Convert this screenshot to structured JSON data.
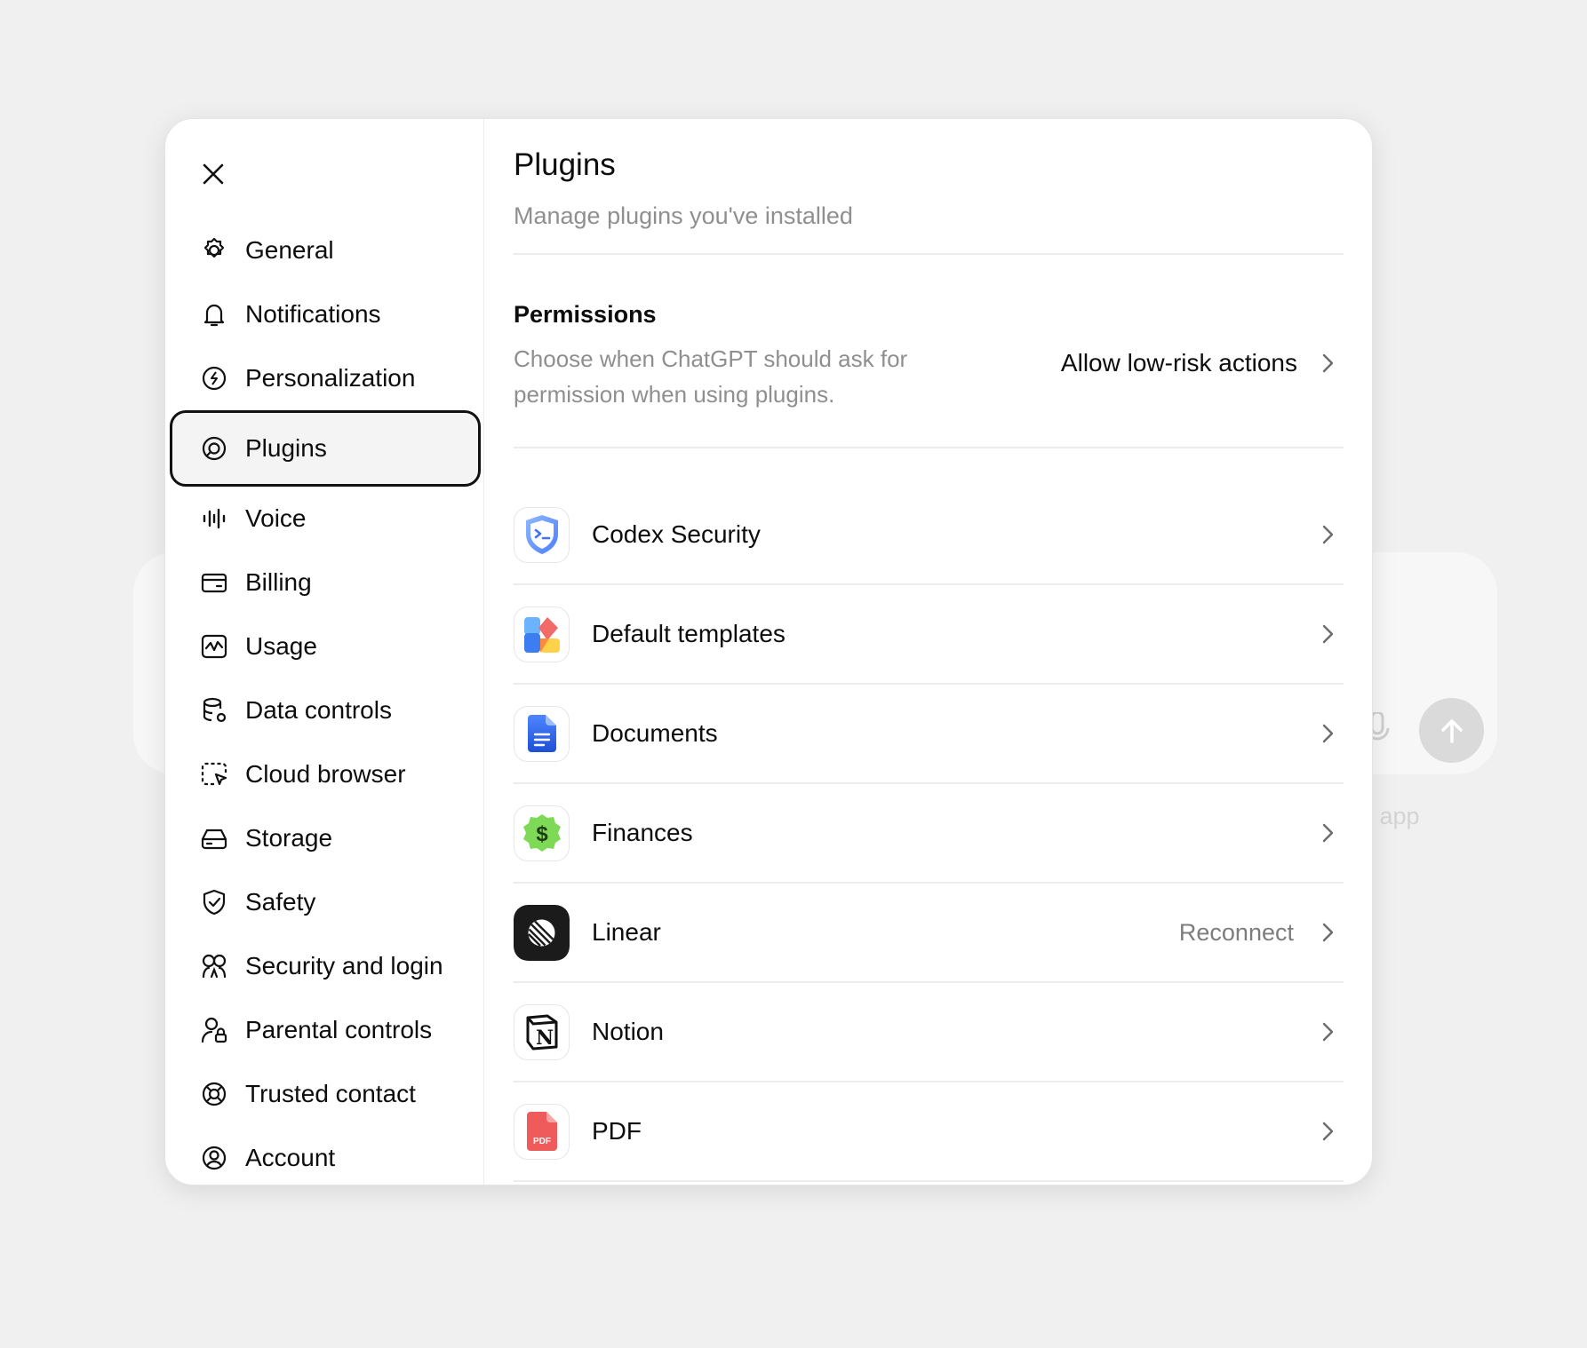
{
  "background": {
    "footer_text": "p app"
  },
  "sidebar": {
    "close_label": "Close",
    "items": [
      {
        "label": "General",
        "icon": "gear-icon"
      },
      {
        "label": "Notifications",
        "icon": "bell-icon"
      },
      {
        "label": "Personalization",
        "icon": "personalization-icon"
      },
      {
        "label": "Plugins",
        "icon": "plugin-icon",
        "active": true
      },
      {
        "label": "Voice",
        "icon": "waveform-icon"
      },
      {
        "label": "Billing",
        "icon": "wallet-icon"
      },
      {
        "label": "Usage",
        "icon": "activity-icon"
      },
      {
        "label": "Data controls",
        "icon": "database-gear-icon"
      },
      {
        "label": "Cloud browser",
        "icon": "browser-cursor-icon"
      },
      {
        "label": "Storage",
        "icon": "drive-icon"
      },
      {
        "label": "Safety",
        "icon": "shield-check-icon"
      },
      {
        "label": "Security and login",
        "icon": "people-security-icon"
      },
      {
        "label": "Parental controls",
        "icon": "person-lock-icon"
      },
      {
        "label": "Trusted contact",
        "icon": "lifebuoy-icon"
      },
      {
        "label": "Account",
        "icon": "user-circle-icon"
      }
    ]
  },
  "main": {
    "title": "Plugins",
    "subtitle": "Manage plugins you've installed",
    "permissions": {
      "title": "Permissions",
      "description": "Choose when ChatGPT should ask for permission when using plugins.",
      "value": "Allow low-risk actions"
    },
    "plugins": [
      {
        "name": "Codex Security",
        "icon": "codex-security-logo",
        "status": ""
      },
      {
        "name": "Default templates",
        "icon": "templates-logo",
        "status": ""
      },
      {
        "name": "Documents",
        "icon": "documents-logo",
        "status": ""
      },
      {
        "name": "Finances",
        "icon": "finances-logo",
        "status": ""
      },
      {
        "name": "Linear",
        "icon": "linear-logo",
        "status": "Reconnect"
      },
      {
        "name": "Notion",
        "icon": "notion-logo",
        "status": ""
      },
      {
        "name": "PDF",
        "icon": "pdf-logo",
        "status": ""
      }
    ]
  }
}
